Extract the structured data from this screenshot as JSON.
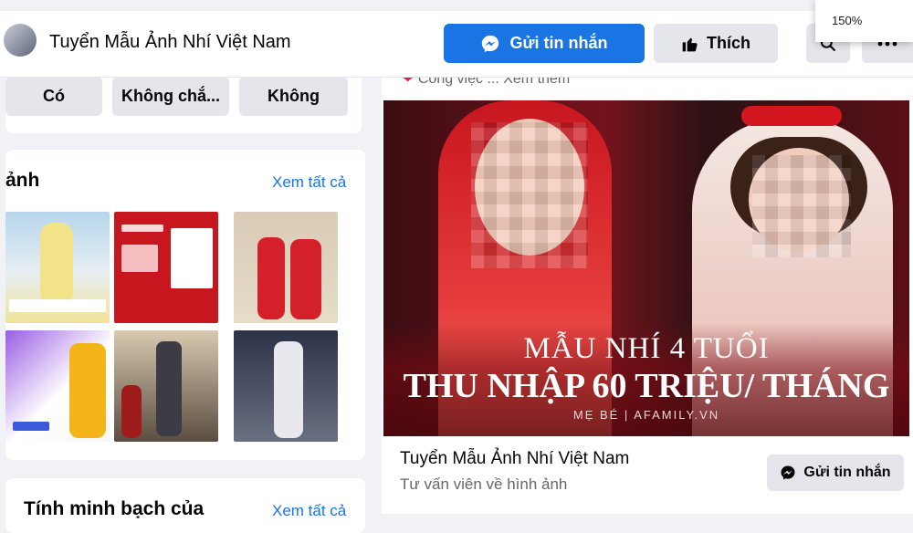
{
  "header": {
    "page_name": "Tuyển Mẫu Ảnh Nhí Việt Nam",
    "send_button": "Gửi tin nhắn",
    "like_button": "Thích"
  },
  "zoom": {
    "level": "150%"
  },
  "options": [
    "Có",
    "Không chắ...",
    "Không"
  ],
  "photos_card": {
    "title_fragment": "ảnh",
    "see_all": "Xem tất cả"
  },
  "transparency_card": {
    "title": "Tính minh bạch của",
    "see_all": "Xem tất cả"
  },
  "post": {
    "work_line": "Công việc ... Xem thêm",
    "banner_line1": "MẪU NHÍ 4 TUỔI",
    "banner_line2": "THU NHẬP 60 TRIỆU/ THÁNG",
    "banner_line3": "MẸ BÉ  |  AFAMILY.VN",
    "page_name": "Tuyển Mẫu Ảnh Nhí Việt Nam",
    "subtitle": "Tư vấn viên về hình ảnh",
    "message_button": "Gửi tin nhắn"
  },
  "icons": {
    "messenger": "messenger-icon",
    "like": "thumbs-up-icon",
    "search": "search-icon",
    "more": "more-icon"
  },
  "colors": {
    "primary_blue": "#1b74e4",
    "button_gray": "#e4e6eb",
    "page_background": "#f0f2f5",
    "banner_red": "#c8161f"
  }
}
